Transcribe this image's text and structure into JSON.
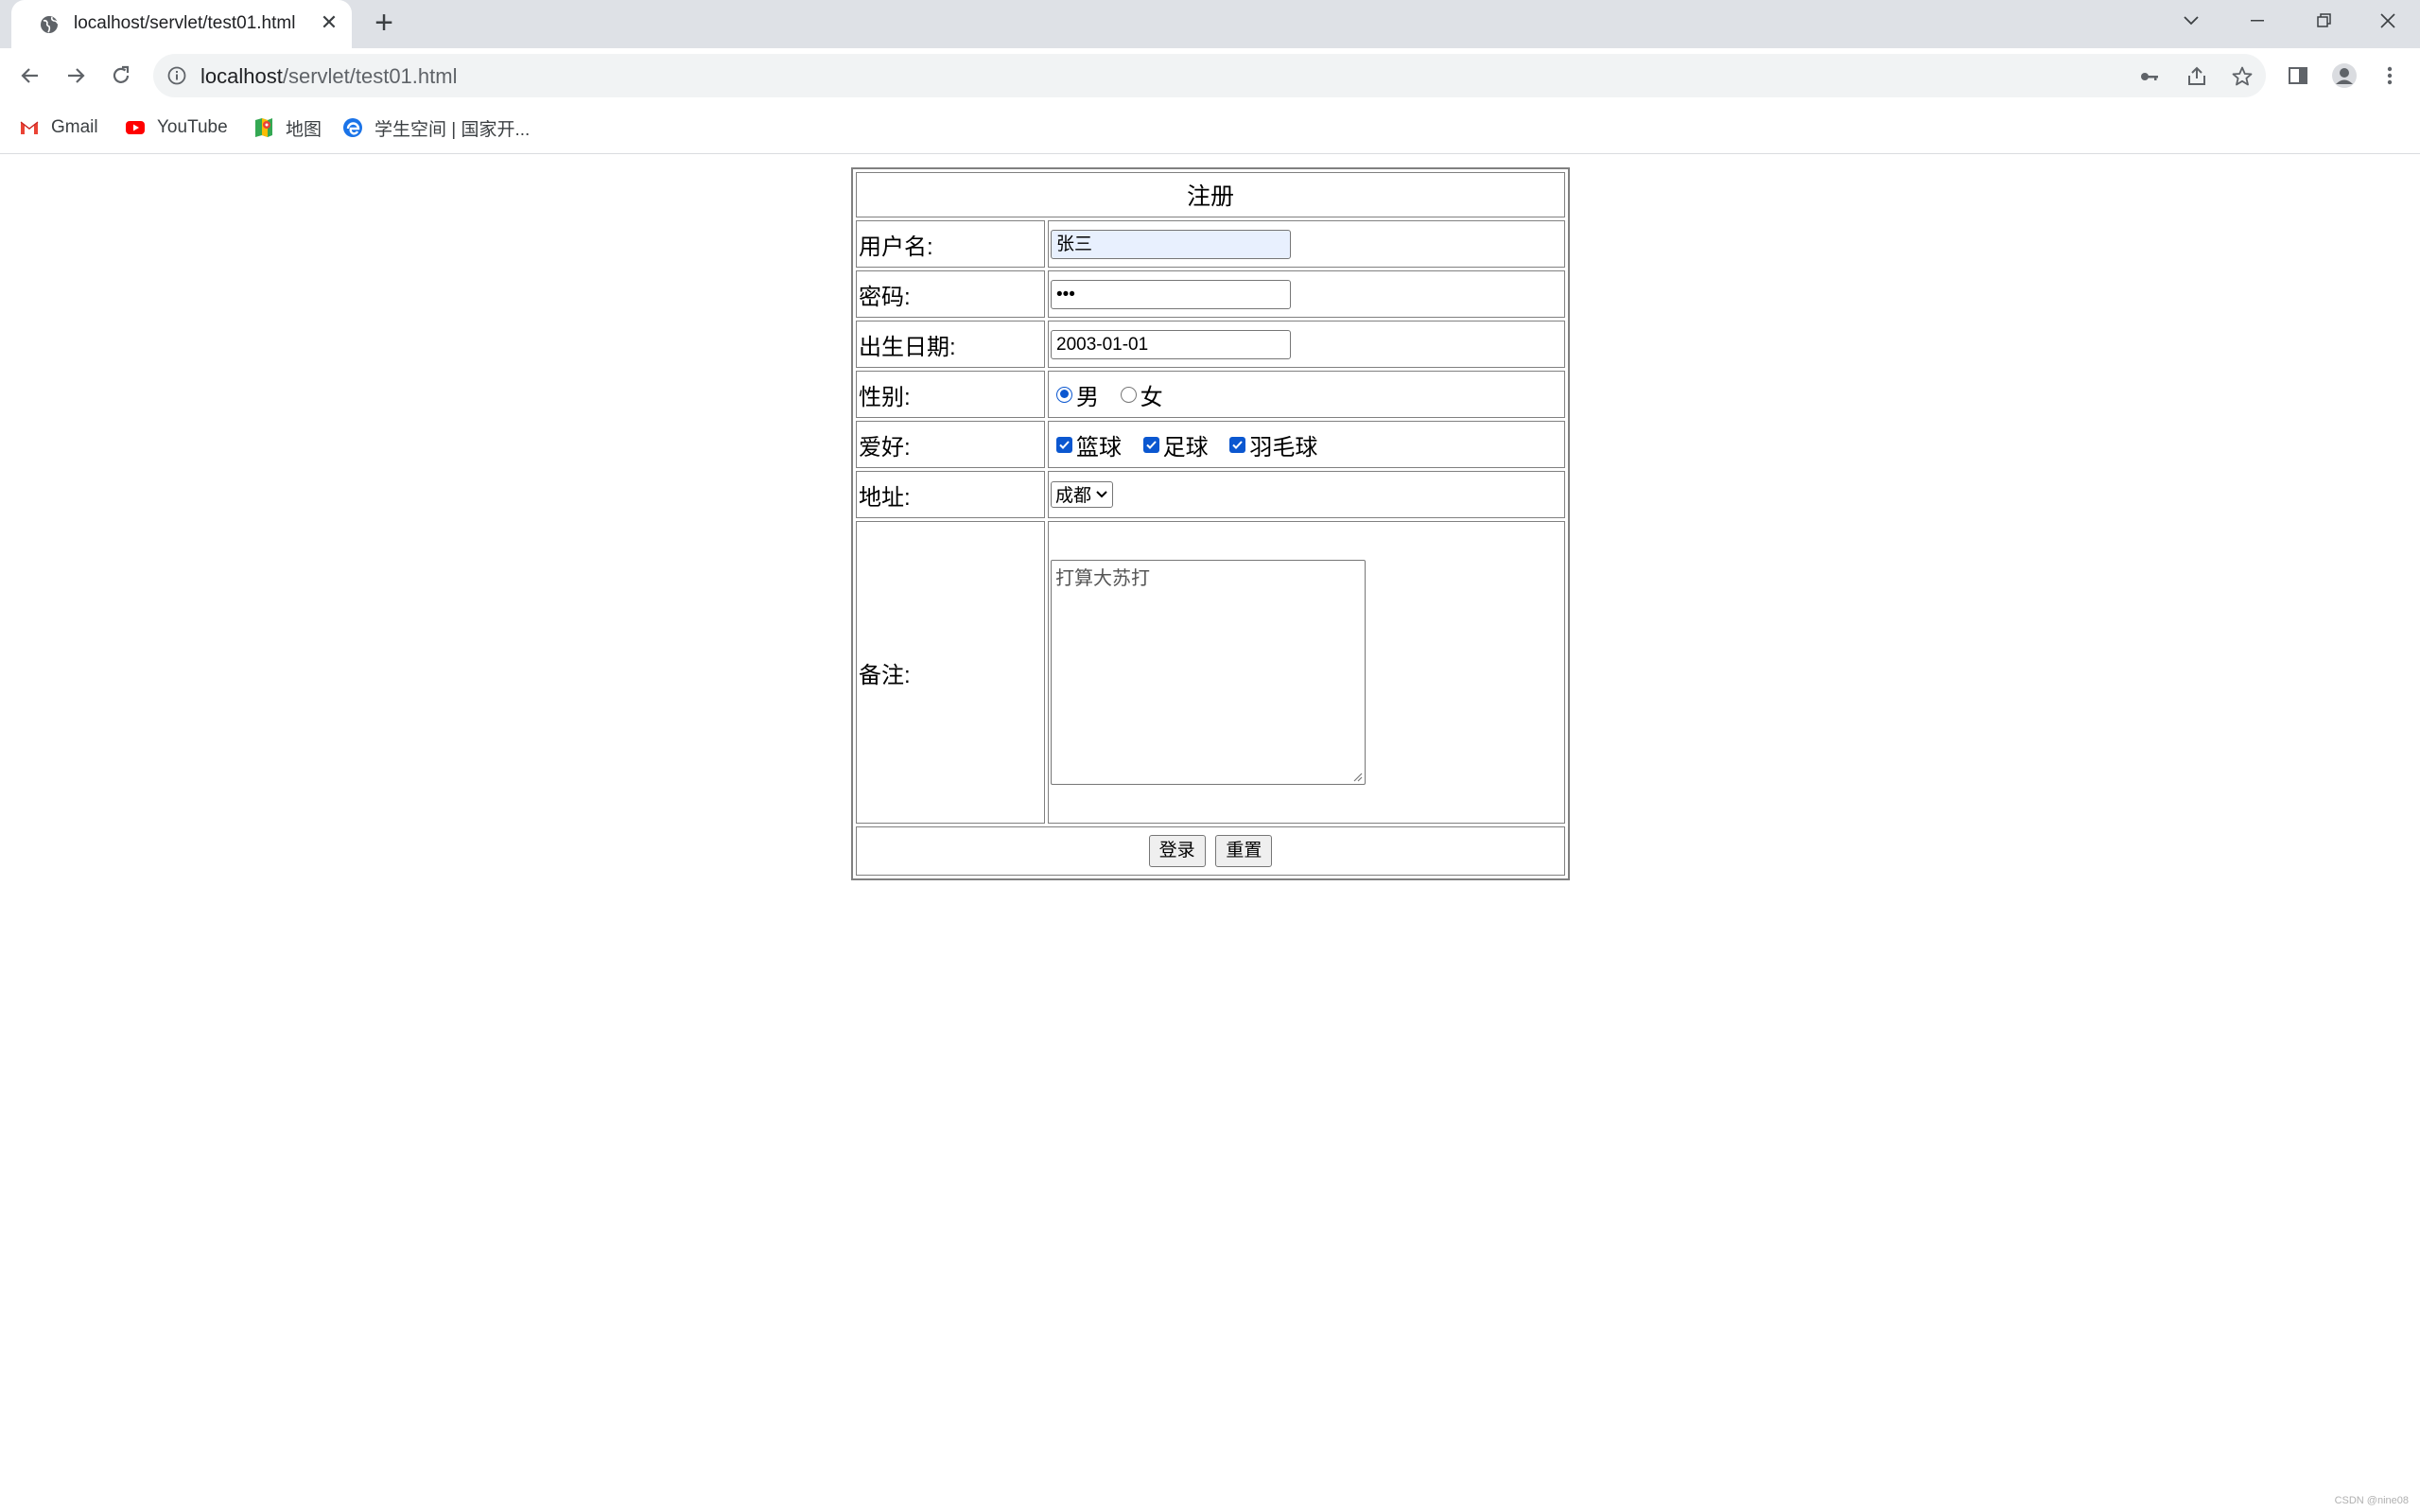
{
  "browser": {
    "tab_title": "localhost/servlet/test01.html",
    "url_host": "localhost",
    "url_path": "/servlet/test01.html",
    "bookmarks": [
      {
        "label": "Gmail",
        "icon": "gmail-icon"
      },
      {
        "label": "YouTube",
        "icon": "youtube-icon"
      },
      {
        "label": "地图",
        "icon": "maps-icon"
      },
      {
        "label": "学生空间 | 国家开...",
        "icon": "edge-icon"
      }
    ]
  },
  "form": {
    "title": "注册",
    "username_label": "用户名:",
    "username_value": "张三",
    "password_label": "密码:",
    "password_value": "•••",
    "birth_label": "出生日期:",
    "birth_value": "2003-01-01",
    "gender_label": "性别:",
    "gender_options": [
      {
        "label": "男",
        "checked": true
      },
      {
        "label": "女",
        "checked": false
      }
    ],
    "hobby_label": "爱好:",
    "hobby_options": [
      {
        "label": "篮球",
        "checked": true
      },
      {
        "label": "足球",
        "checked": true
      },
      {
        "label": "羽毛球",
        "checked": true
      }
    ],
    "address_label": "地址:",
    "address_selected": "成都",
    "remark_label": "备注:",
    "remark_value": "打算大苏打",
    "submit_label": "登录",
    "reset_label": "重置"
  },
  "watermark": "CSDN @nine08",
  "colors": {
    "accent": "#0b57d0",
    "tabstrip": "#dee1e6",
    "omnibox": "#f1f3f4"
  }
}
